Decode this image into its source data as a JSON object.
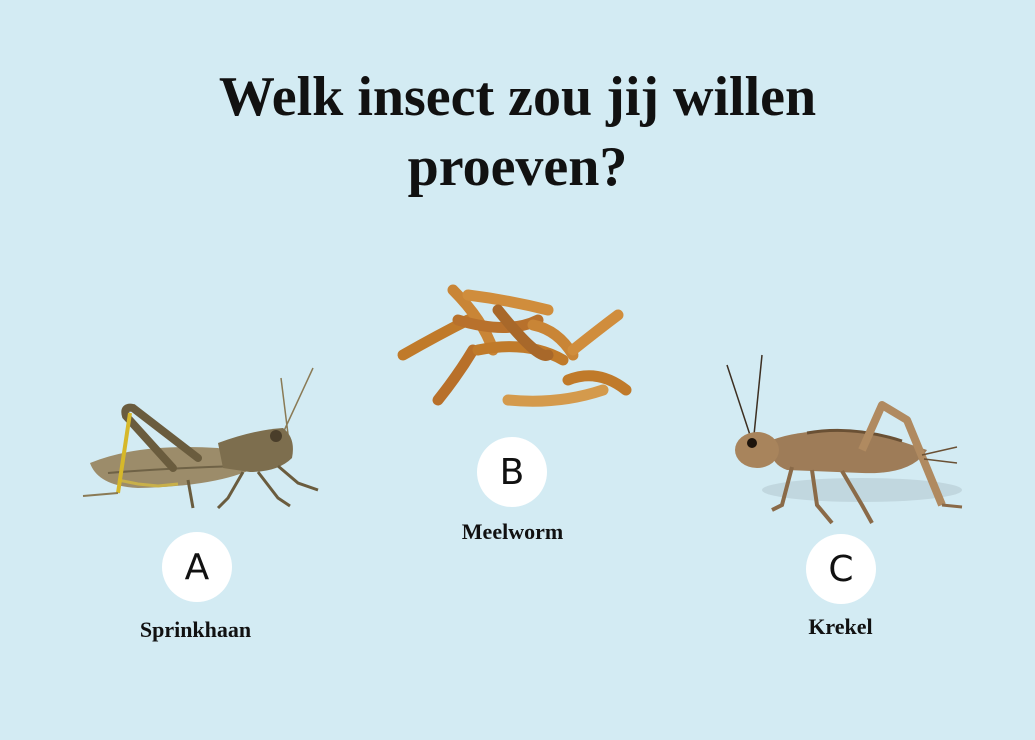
{
  "title": {
    "line1": "Welk insect zou jij willen",
    "line2": "proeven?"
  },
  "options": [
    {
      "letter": "A",
      "name": "Sprinkhaan",
      "icon": "grasshopper-image"
    },
    {
      "letter": "B",
      "name": "Meelworm",
      "icon": "mealworm-image"
    },
    {
      "letter": "C",
      "name": "Krekel",
      "icon": "cricket-image"
    }
  ],
  "colors": {
    "background": "#d3ebf3",
    "badge": "#ffffff",
    "text": "#111111"
  }
}
